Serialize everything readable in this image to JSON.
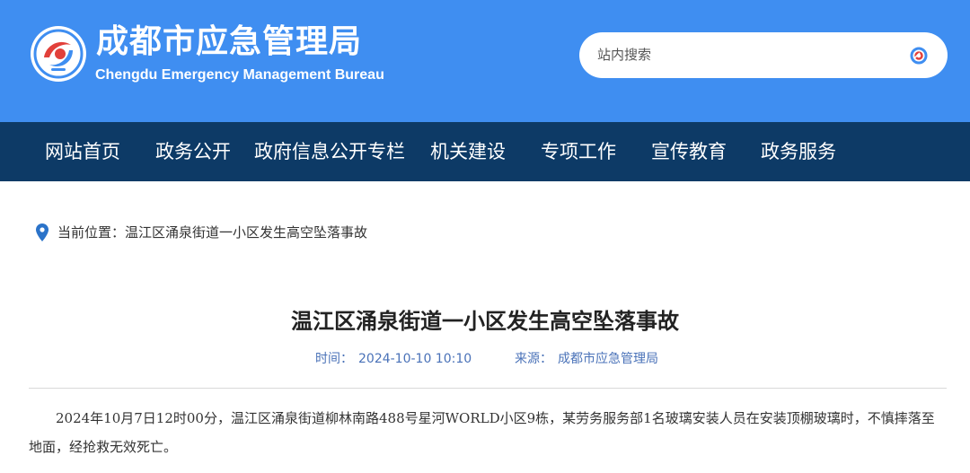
{
  "header": {
    "title": "成都市应急管理局",
    "subtitle": "Chengdu Emergency Management Bureau",
    "logo_icon": "emergency-bureau-emblem",
    "search": {
      "placeholder": "站内搜索",
      "button_icon": "search-icon"
    },
    "colors": {
      "header_bg": "#3f8ef1",
      "nav_bg": "#0d3a66"
    }
  },
  "nav": {
    "items": [
      {
        "label": "网站首页"
      },
      {
        "label": "政务公开"
      },
      {
        "label": "政府信息公开专栏"
      },
      {
        "label": "机关建设"
      },
      {
        "label": "专项工作"
      },
      {
        "label": "宣传教育"
      },
      {
        "label": "政务服务"
      }
    ]
  },
  "breadcrumb": {
    "icon": "location-pin-icon",
    "label": "当前位置：",
    "current": "温江区涌泉街道一小区发生高空坠落事故"
  },
  "article": {
    "title": "温江区涌泉街道一小区发生高空坠落事故",
    "time_label": "时间：",
    "time_value": "2024-10-10 10:10",
    "source_label": "来源：",
    "source_value": "成都市应急管理局",
    "body": "2024年10月7日12时00分，温江区涌泉街道柳林南路488号星河WORLD小区9栋，某劳务服务部1名玻璃安装人员在安装顶棚玻璃时，不慎摔落至地面，经抢救无效死亡。"
  }
}
